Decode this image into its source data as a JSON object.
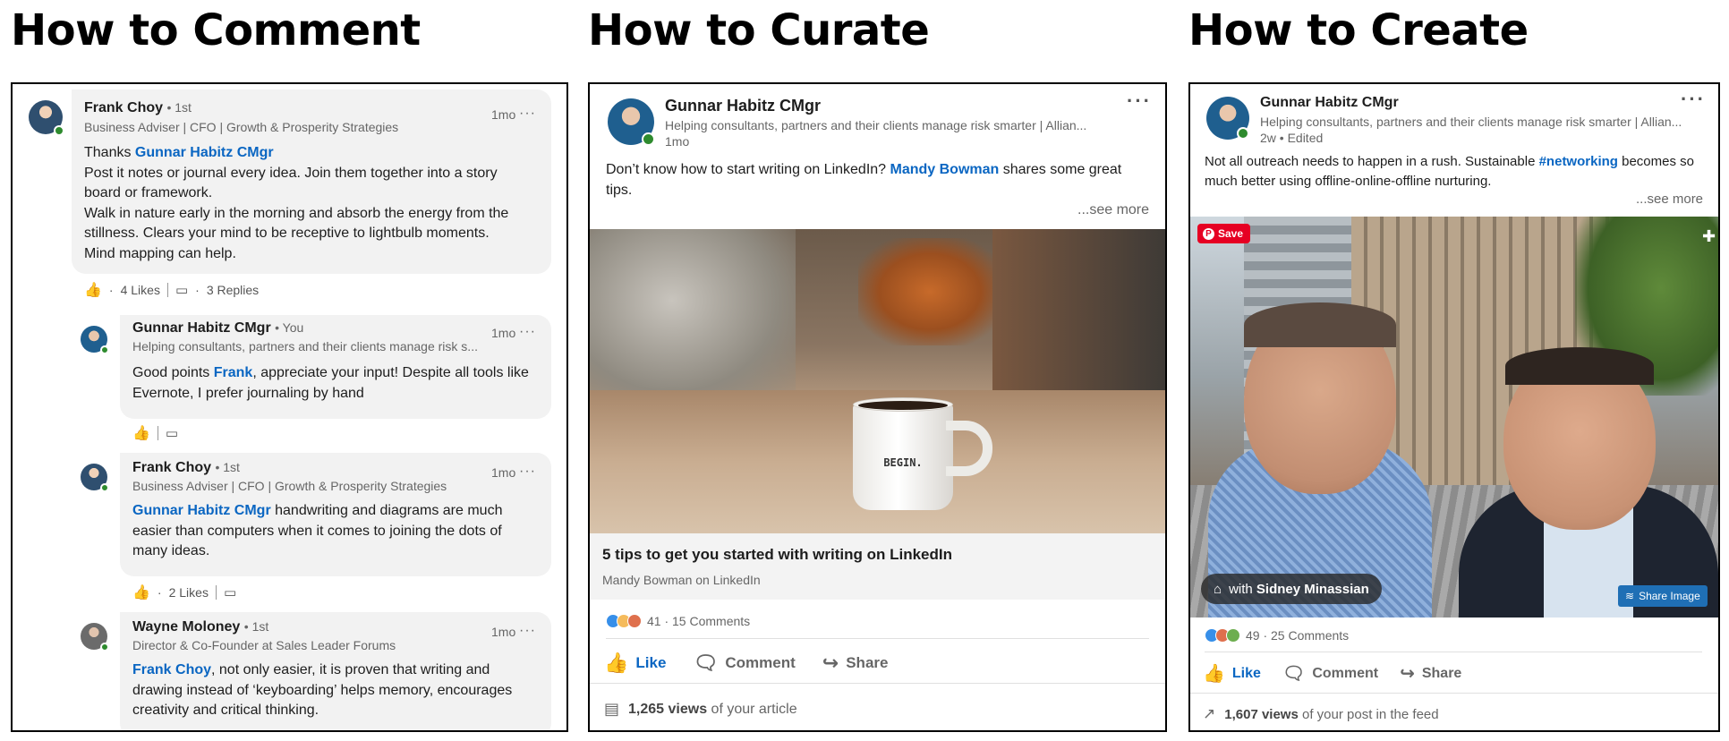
{
  "headings": [
    "How to Comment",
    "How to Curate",
    "How to Create"
  ],
  "comments": [
    {
      "name": "Frank Choy",
      "degree": "1st",
      "subtitle": "Business Adviser | CFO | Growth & Prosperity Strategies",
      "time": "1mo",
      "prefix": "Thanks ",
      "mention": "Gunnar Habitz CMgr",
      "body": "Post it notes or journal every idea. Join them together into a story board or framework.\nWalk in nature early in the morning and absorb the energy from the stillness. Clears your mind to be receptive to lightbulb moments.\nMind mapping can help.",
      "likes": "4 Likes",
      "replies": "3 Replies"
    },
    {
      "name": "Gunnar Habitz CMgr",
      "degree": "You",
      "subtitle": "Helping consultants, partners and their clients manage risk s...",
      "time": "1mo",
      "prefix": "Good points ",
      "mention": "Frank",
      "body": ", appreciate your input! Despite all tools like Evernote, I prefer journaling by hand"
    },
    {
      "name": "Frank Choy",
      "degree": "1st",
      "subtitle": "Business Adviser | CFO | Growth & Prosperity Strategies",
      "time": "1mo",
      "mention": "Gunnar Habitz CMgr",
      "body": " handwriting and diagrams are much easier than computers when it comes to joining the dots of many ideas.",
      "likes": "2 Likes"
    },
    {
      "name": "Wayne Moloney",
      "degree": "1st",
      "subtitle": "Director & Co-Founder at Sales Leader Forums",
      "time": "1mo",
      "mention": "Frank Choy",
      "body": ", not only easier, it is proven that writing and drawing instead of ‘keyboarding’ helps memory, encourages creativity and critical thinking."
    }
  ],
  "curate": {
    "name": "Gunnar Habitz CMgr",
    "subtitle": "Helping consultants, partners and their clients manage risk smarter | Allian...",
    "time": "1mo",
    "text_before": "Don’t know how to start writing on LinkedIn? ",
    "mention": "Mandy Bowman",
    "text_after": " shares some great tips.",
    "see_more": "...see more",
    "mug_text": "BEGIN.",
    "article_title": "5 tips to get you started with writing on LinkedIn",
    "article_source": "Mandy Bowman on LinkedIn",
    "reactions": "41 · 15 Comments",
    "actions": [
      "Like",
      "Comment",
      "Share"
    ],
    "views_count": "1,265 views",
    "views_suffix": "of your article"
  },
  "create": {
    "name": "Gunnar Habitz CMgr",
    "subtitle": "Helping consultants, partners and their clients manage risk smarter | Allian...",
    "time": "2w • Edited",
    "text_before": "Not all outreach needs to happen in a rush. Sustainable ",
    "hashtag": "#networking",
    "text_after": " becomes so much better using offline-online-offline nurturing.",
    "see_more": "...see more",
    "save_label": "Save",
    "tag_prefix": "with ",
    "tag_name": "Sidney Minassian",
    "share_image": "Share Image",
    "reactions": "49 · 25 Comments",
    "actions": [
      "Like",
      "Comment",
      "Share"
    ],
    "views_count": "1,607 views",
    "views_suffix": "of your post in the feed"
  }
}
